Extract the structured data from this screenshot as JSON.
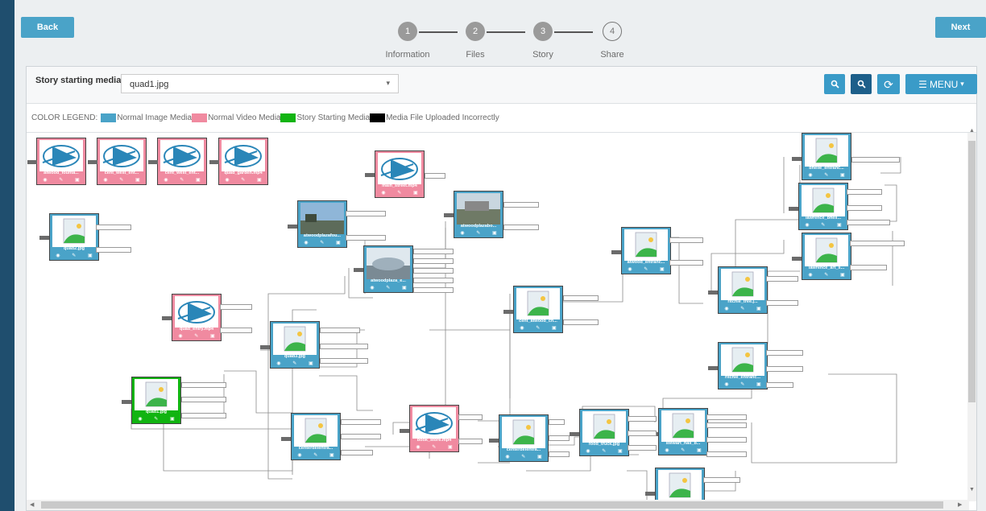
{
  "nav": {
    "back_label": "Back",
    "next_label": "Next"
  },
  "steps": [
    {
      "number": "1",
      "label": "Information"
    },
    {
      "number": "2",
      "label": "Files"
    },
    {
      "number": "3",
      "label": "Story"
    },
    {
      "number": "4",
      "label": "Share"
    }
  ],
  "start_media": {
    "label": "Story starting media:",
    "value": "quad1.jpg"
  },
  "toolbar": {
    "zoom_in_icon": "zoom-in-icon",
    "zoom_out_icon": "zoom-out-icon",
    "refresh_icon": "refresh-icon",
    "menu_label": "MENU"
  },
  "legend": {
    "title": "COLOR LEGEND:",
    "items": [
      {
        "label": "Normal Image Media",
        "color": "#4aa3c8"
      },
      {
        "label": "Normal Video Media",
        "color": "#f08aa0"
      },
      {
        "label": "Story Starting Media",
        "color": "#11b411"
      },
      {
        "label": "Media File Uploaded Incorrectly",
        "color": "#000000"
      }
    ]
  },
  "nodes": [
    {
      "label": "atwood_founta...",
      "kind": "video"
    },
    {
      "label": "cent_west_ent...",
      "kind": "video"
    },
    {
      "label": "cent_west_ent...",
      "kind": "video"
    },
    {
      "label": "quad_garden.mp4",
      "kind": "video"
    },
    {
      "label": "main_street.mp4",
      "kind": "video"
    },
    {
      "label": "quad2.jpg",
      "kind": "image"
    },
    {
      "label": "atwoodplazafou...",
      "kind": "photo"
    },
    {
      "label": "atwoodplazabo...",
      "kind": "photo"
    },
    {
      "label": "atwoodplaza_e...",
      "kind": "photo"
    },
    {
      "label": "quad_entry.mp4",
      "kind": "video"
    },
    {
      "label": "quad3.jpg",
      "kind": "image"
    },
    {
      "label": "quad1.jpg",
      "kind": "start"
    },
    {
      "label": "centerdelentra...",
      "kind": "image"
    },
    {
      "label": "book_store.mp4",
      "kind": "video"
    },
    {
      "label": "centerdelentra...",
      "kind": "image"
    },
    {
      "label": "food_truck.jpg",
      "kind": "image"
    },
    {
      "label": "stewart_hall_b...",
      "kind": "image"
    },
    {
      "label": "cent_atwood_ch...",
      "kind": "image"
    },
    {
      "label": "atwood_entranc...",
      "kind": "image"
    },
    {
      "label": "ritchie_tree.j...",
      "kind": "image"
    },
    {
      "label": "ritchie_entranc...",
      "kind": "image"
    },
    {
      "label": "bhelle_entranc...",
      "kind": "image"
    },
    {
      "label": "lawrence_bhell...",
      "kind": "image"
    },
    {
      "label": "lawrence_art_s...",
      "kind": "image"
    },
    {
      "label": "",
      "kind": "image"
    }
  ]
}
